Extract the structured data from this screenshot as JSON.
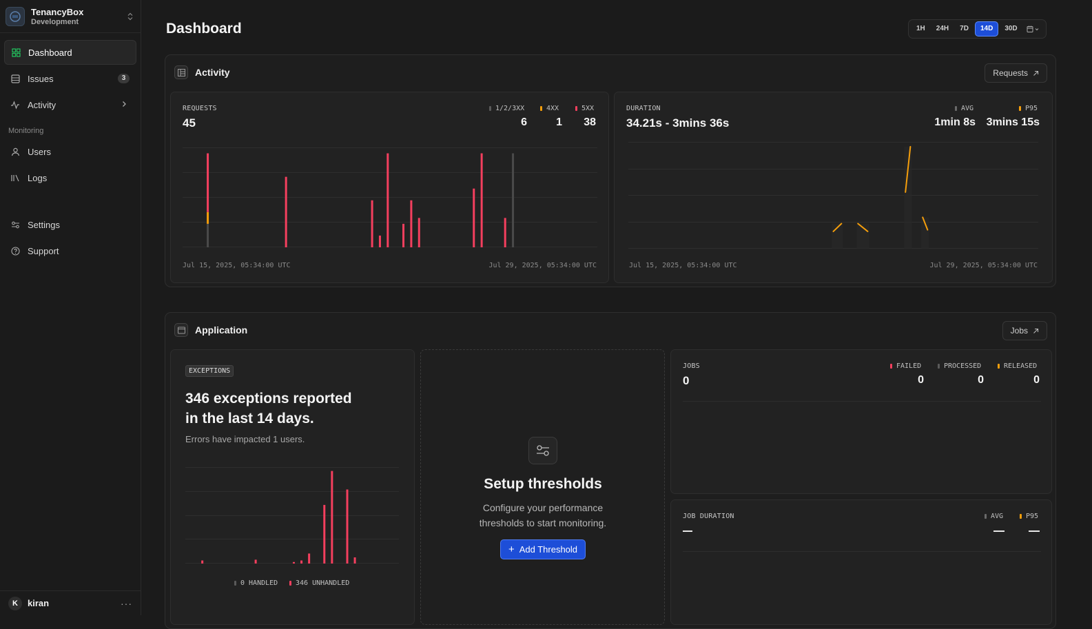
{
  "sidebar": {
    "org_name": "TenancyBox",
    "org_env": "Development",
    "nav": [
      {
        "label": "Dashboard",
        "icon": "grid-icon",
        "active": true
      },
      {
        "label": "Issues",
        "icon": "inbox-icon",
        "badge": "3"
      },
      {
        "label": "Activity",
        "icon": "activity-icon"
      }
    ],
    "monitoring_label": "Monitoring",
    "monitoring": [
      {
        "label": "Users",
        "icon": "user-icon"
      },
      {
        "label": "Logs",
        "icon": "logs-icon"
      }
    ],
    "bottom": [
      {
        "label": "Settings",
        "icon": "sliders-icon"
      },
      {
        "label": "Support",
        "icon": "help-icon"
      }
    ],
    "user": {
      "initial": "K",
      "name": "kiran"
    }
  },
  "header": {
    "title": "Dashboard",
    "ranges": [
      "1H",
      "24H",
      "7D",
      "14D",
      "30D"
    ],
    "active_range": "14D"
  },
  "activity": {
    "title": "Activity",
    "link": "Requests",
    "requests": {
      "caption": "REQUESTS",
      "total": "45",
      "legend": [
        {
          "label": "1/2/3XX",
          "value": "6",
          "color": "#5a5a5a"
        },
        {
          "label": "4XX",
          "value": "1",
          "color": "#f59e0b"
        },
        {
          "label": "5XX",
          "value": "38",
          "color": "#f43f5e"
        }
      ],
      "start": "Jul 15, 2025, 05:34:00 UTC",
      "end": "Jul 29, 2025, 05:34:00 UTC"
    },
    "duration": {
      "caption": "DURATION",
      "range": "34.21s - 3mins 36s",
      "legend": [
        {
          "label": "AVG",
          "value": "1min 8s",
          "color": "#6a6a6a"
        },
        {
          "label": "P95",
          "value": "3mins 15s",
          "color": "#f59e0b"
        }
      ],
      "start": "Jul 15, 2025, 05:34:00 UTC",
      "end": "Jul 29, 2025, 05:34:00 UTC"
    }
  },
  "application": {
    "title": "Application",
    "link": "Jobs",
    "exceptions": {
      "tag": "EXCEPTIONS",
      "title": "346 exceptions reported in the last 14 days.",
      "subtitle": "Errors have impacted 1 users.",
      "legend": [
        {
          "label": "0 HANDLED",
          "color": "#5a5a5a"
        },
        {
          "label": "346 UNHANDLED",
          "color": "#f43f5e"
        }
      ]
    },
    "setup": {
      "title": "Setup thresholds",
      "description": "Configure your performance thresholds to start monitoring.",
      "button": "Add Threshold"
    },
    "jobs": {
      "caption": "JOBS",
      "total": "0",
      "legend": [
        {
          "label": "FAILED",
          "value": "0",
          "color": "#f43f5e"
        },
        {
          "label": "PROCESSED",
          "value": "0",
          "color": "#5a5a5a"
        },
        {
          "label": "RELEASED",
          "value": "0",
          "color": "#f59e0b"
        }
      ]
    },
    "job_duration": {
      "caption": "JOB DURATION",
      "legend": [
        {
          "label": "AVG",
          "color": "#6a6a6a"
        },
        {
          "label": "P95",
          "color": "#f59e0b"
        }
      ]
    }
  },
  "chart_data": [
    {
      "type": "bar",
      "name": "requests",
      "stacked": true,
      "series": [
        {
          "name": "1/2/3XX",
          "color": "#4a4a4a",
          "points": [
            [
              3,
              2
            ],
            [
              42,
              8
            ]
          ]
        },
        {
          "name": "4XX",
          "color": "#f59e0b",
          "points": [
            [
              3,
              1
            ]
          ]
        },
        {
          "name": "5XX",
          "color": "#f43f5e",
          "points": [
            [
              3,
              5
            ],
            [
              13,
              6
            ],
            [
              24,
              4
            ],
            [
              25,
              1
            ],
            [
              26,
              8
            ],
            [
              28,
              2
            ],
            [
              29,
              4
            ],
            [
              30,
              2.5
            ],
            [
              37,
              5
            ],
            [
              38,
              8
            ],
            [
              41,
              2.5
            ]
          ]
        }
      ],
      "x_range": [
        0,
        53
      ],
      "ylim": [
        0,
        8.5
      ]
    },
    {
      "type": "line",
      "name": "duration",
      "series": [
        {
          "name": "P95",
          "color": "#f59e0b",
          "segments": [
            [
              [
                25,
                0.55
              ],
              [
                26,
                0.8
              ]
            ],
            [
              [
                28,
                0.8
              ],
              [
                29.2,
                0.55
              ]
            ],
            [
              [
                33.8,
                1.8
              ],
              [
                34.4,
                3.25
              ]
            ],
            [
              [
                35.9,
                1.0
              ],
              [
                36.5,
                0.6
              ]
            ]
          ]
        }
      ],
      "x_range": [
        0,
        50
      ],
      "ylim": [
        0,
        3.4
      ]
    },
    {
      "type": "bar",
      "name": "exceptions",
      "series": [
        {
          "name": "Unhandled",
          "color": "#f43f5e",
          "points": [
            [
              2,
              4
            ],
            [
              9,
              5
            ],
            [
              14,
              2
            ],
            [
              15,
              4
            ],
            [
              16,
              13
            ],
            [
              18,
              76
            ],
            [
              19,
              120
            ],
            [
              21,
              96
            ],
            [
              22,
              8
            ]
          ]
        }
      ],
      "x_range": [
        0,
        28
      ],
      "ylim": [
        0,
        125
      ]
    }
  ]
}
